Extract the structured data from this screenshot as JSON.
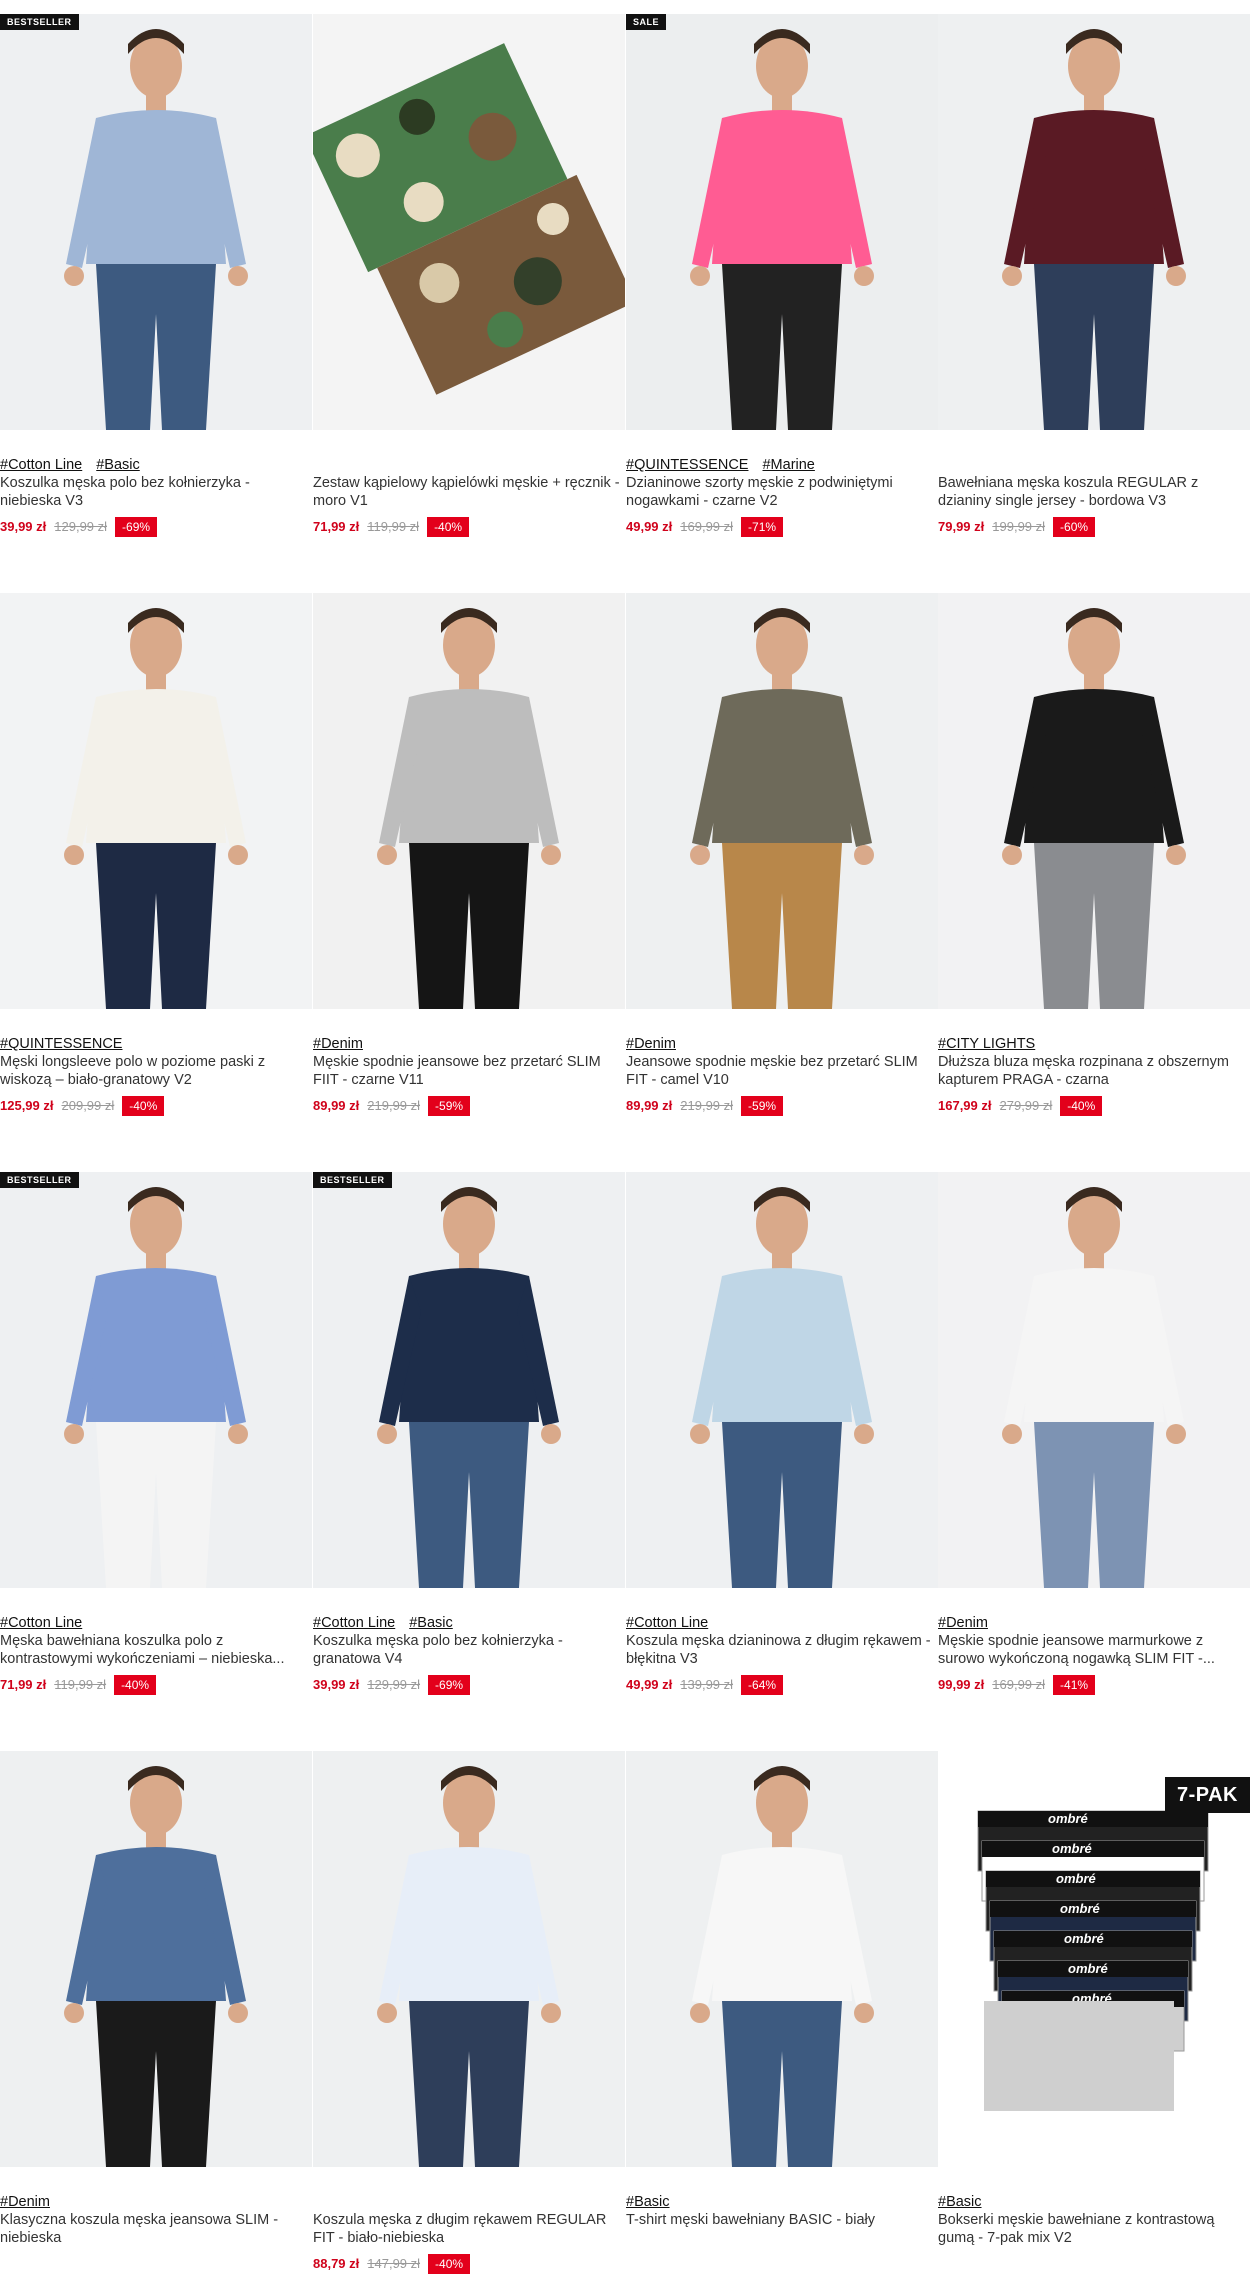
{
  "products": [
    {
      "badge": "BESTSELLER",
      "tags": [
        "#Cotton Line",
        "#Basic"
      ],
      "title": "Koszulka męska polo bez kołnierzyka - niebieska V3",
      "price": "39,99 zł",
      "old": "129,99 zł",
      "disc": "-69%",
      "img": "polo-blue-man",
      "bg": "#eef0f2",
      "garment": "#9fb6d6",
      "pants": "#3d5a80"
    },
    {
      "badge": "",
      "tags": [],
      "title": "Zestaw kąpielowy kąpielówki męskie + ręcznik - moro V1",
      "price": "71,99 zł",
      "old": "119,99 zł",
      "disc": "-40%",
      "img": "camo-swim-set",
      "bg": "#f4f4f4",
      "garment": "#4a7d4b",
      "pants": "#7a5a3c"
    },
    {
      "badge": "SALE",
      "tags": [
        "#QUINTESSENCE",
        "#Marine"
      ],
      "title": "Dzianinowe szorty męskie z podwiniętymi nogawkami - czarne V2",
      "price": "49,99 zł",
      "old": "169,99 zł",
      "disc": "-71%",
      "img": "black-shorts",
      "bg": "#eceeef",
      "garment": "#ff5c93",
      "pants": "#222222"
    },
    {
      "badge": "",
      "tags": [],
      "title": "Bawełniana męska koszula REGULAR z dzianiny single jersey - bordowa V3",
      "price": "79,99 zł",
      "old": "199,99 zł",
      "disc": "-60%",
      "img": "burgundy-shirt",
      "bg": "#eef0f1",
      "garment": "#5a1a24",
      "pants": "#2e3e5a"
    },
    {
      "badge": "",
      "tags": [
        "#QUINTESSENCE"
      ],
      "title": "Męski longsleeve polo w poziome paski z wiskozą – biało-granatowy V2",
      "price": "125,99 zł",
      "old": "209,99 zł",
      "disc": "-40%",
      "img": "striped-longsleeve",
      "bg": "#f2f3f4",
      "garment": "#f3f1ea",
      "pants": "#1e2a44"
    },
    {
      "badge": "",
      "tags": [
        "#Denim"
      ],
      "title": "Męskie spodnie jeansowe bez przetarć SLIM FIIT - czarne V11",
      "price": "89,99 zł",
      "old": "219,99 zł",
      "disc": "-59%",
      "img": "black-jeans",
      "bg": "#f1f1f1",
      "garment": "#bdbdbd",
      "pants": "#151515"
    },
    {
      "badge": "",
      "tags": [
        "#Denim"
      ],
      "title": "Jeansowe spodnie męskie bez przetarć SLIM FIT - camel V10",
      "price": "89,99 zł",
      "old": "219,99 zł",
      "disc": "-59%",
      "img": "camel-jeans",
      "bg": "#eef0f1",
      "garment": "#6e6a5a",
      "pants": "#b8874a"
    },
    {
      "badge": "",
      "tags": [
        "#CITY LIGHTS"
      ],
      "title": "Dłuższa bluza męska rozpinana z obszernym kapturem PRAGA - czarna",
      "price": "167,99 zł",
      "old": "279,99 zł",
      "disc": "-40%",
      "img": "black-hoodie",
      "bg": "#f2f2f3",
      "garment": "#1a1a1a",
      "pants": "#8a8c90"
    },
    {
      "badge": "BESTSELLER",
      "tags": [
        "#Cotton Line"
      ],
      "title": "Męska bawełniana koszulka polo z kontrastowymi wykończeniami – niebieska...",
      "price": "71,99 zł",
      "old": "119,99 zł",
      "disc": "-40%",
      "img": "polo-blue-contrast",
      "bg": "#eef0f2",
      "garment": "#7f9bd4",
      "pants": "#f4f4f4"
    },
    {
      "badge": "BESTSELLER",
      "tags": [
        "#Cotton Line",
        "#Basic"
      ],
      "title": "Koszulka męska polo bez kołnierzyka - granatowa V4",
      "price": "39,99 zł",
      "old": "129,99 zł",
      "disc": "-69%",
      "img": "polo-navy",
      "bg": "#eef0f2",
      "garment": "#1d2d4a",
      "pants": "#3d5a80"
    },
    {
      "badge": "",
      "tags": [
        "#Cotton Line"
      ],
      "title": "Koszula męska dzianinowa z długim rękawem - błękitna V3",
      "price": "49,99 zł",
      "old": "139,99 zł",
      "disc": "-64%",
      "img": "lightblue-shirt",
      "bg": "#eef0f2",
      "garment": "#bfd6e6",
      "pants": "#3d5a80"
    },
    {
      "badge": "",
      "tags": [
        "#Denim"
      ],
      "title": "Męskie spodnie jeansowe marmurkowe z surowo wykończoną nogawką SLIM FIT -...",
      "price": "99,99 zł",
      "old": "169,99 zł",
      "disc": "-41%",
      "img": "marble-jeans",
      "bg": "#f2f2f3",
      "garment": "#f5f5f5",
      "pants": "#7d93b3"
    },
    {
      "badge": "",
      "tags": [
        "#Denim"
      ],
      "title": "Klasyczna koszula męska jeansowa SLIM - niebieska",
      "price": "",
      "old": "",
      "disc": "",
      "img": "denim-shirt",
      "bg": "#eef0f1",
      "garment": "#4e6f9c",
      "pants": "#1a1a1a"
    },
    {
      "badge": "",
      "tags": [],
      "title": "Koszula męska z długim rękawem REGULAR FIT - biało-niebieska",
      "price": "88,79 zł",
      "old": "147,99 zł",
      "disc": "-40%",
      "img": "check-shirt",
      "bg": "#eef0f1",
      "garment": "#e7eef8",
      "pants": "#2e3e5a"
    },
    {
      "badge": "",
      "tags": [
        "#Basic"
      ],
      "title": "T-shirt męski bawełniany BASIC - biały",
      "price": "",
      "old": "",
      "disc": "",
      "img": "white-tshirt",
      "bg": "#eef0f1",
      "garment": "#f7f7f7",
      "pants": "#3d5a80"
    },
    {
      "badge": "7-PAK",
      "tags": [
        "#Basic"
      ],
      "title": "Bokserki męskie bawełniane z kontrastową gumą - 7-pak mix V2",
      "price": "",
      "old": "",
      "disc": "",
      "img": "boxers-pack",
      "bg": "#ffffff",
      "garment": "#222222",
      "pants": "#cfcfcf",
      "boxer_label": "ombré"
    }
  ]
}
